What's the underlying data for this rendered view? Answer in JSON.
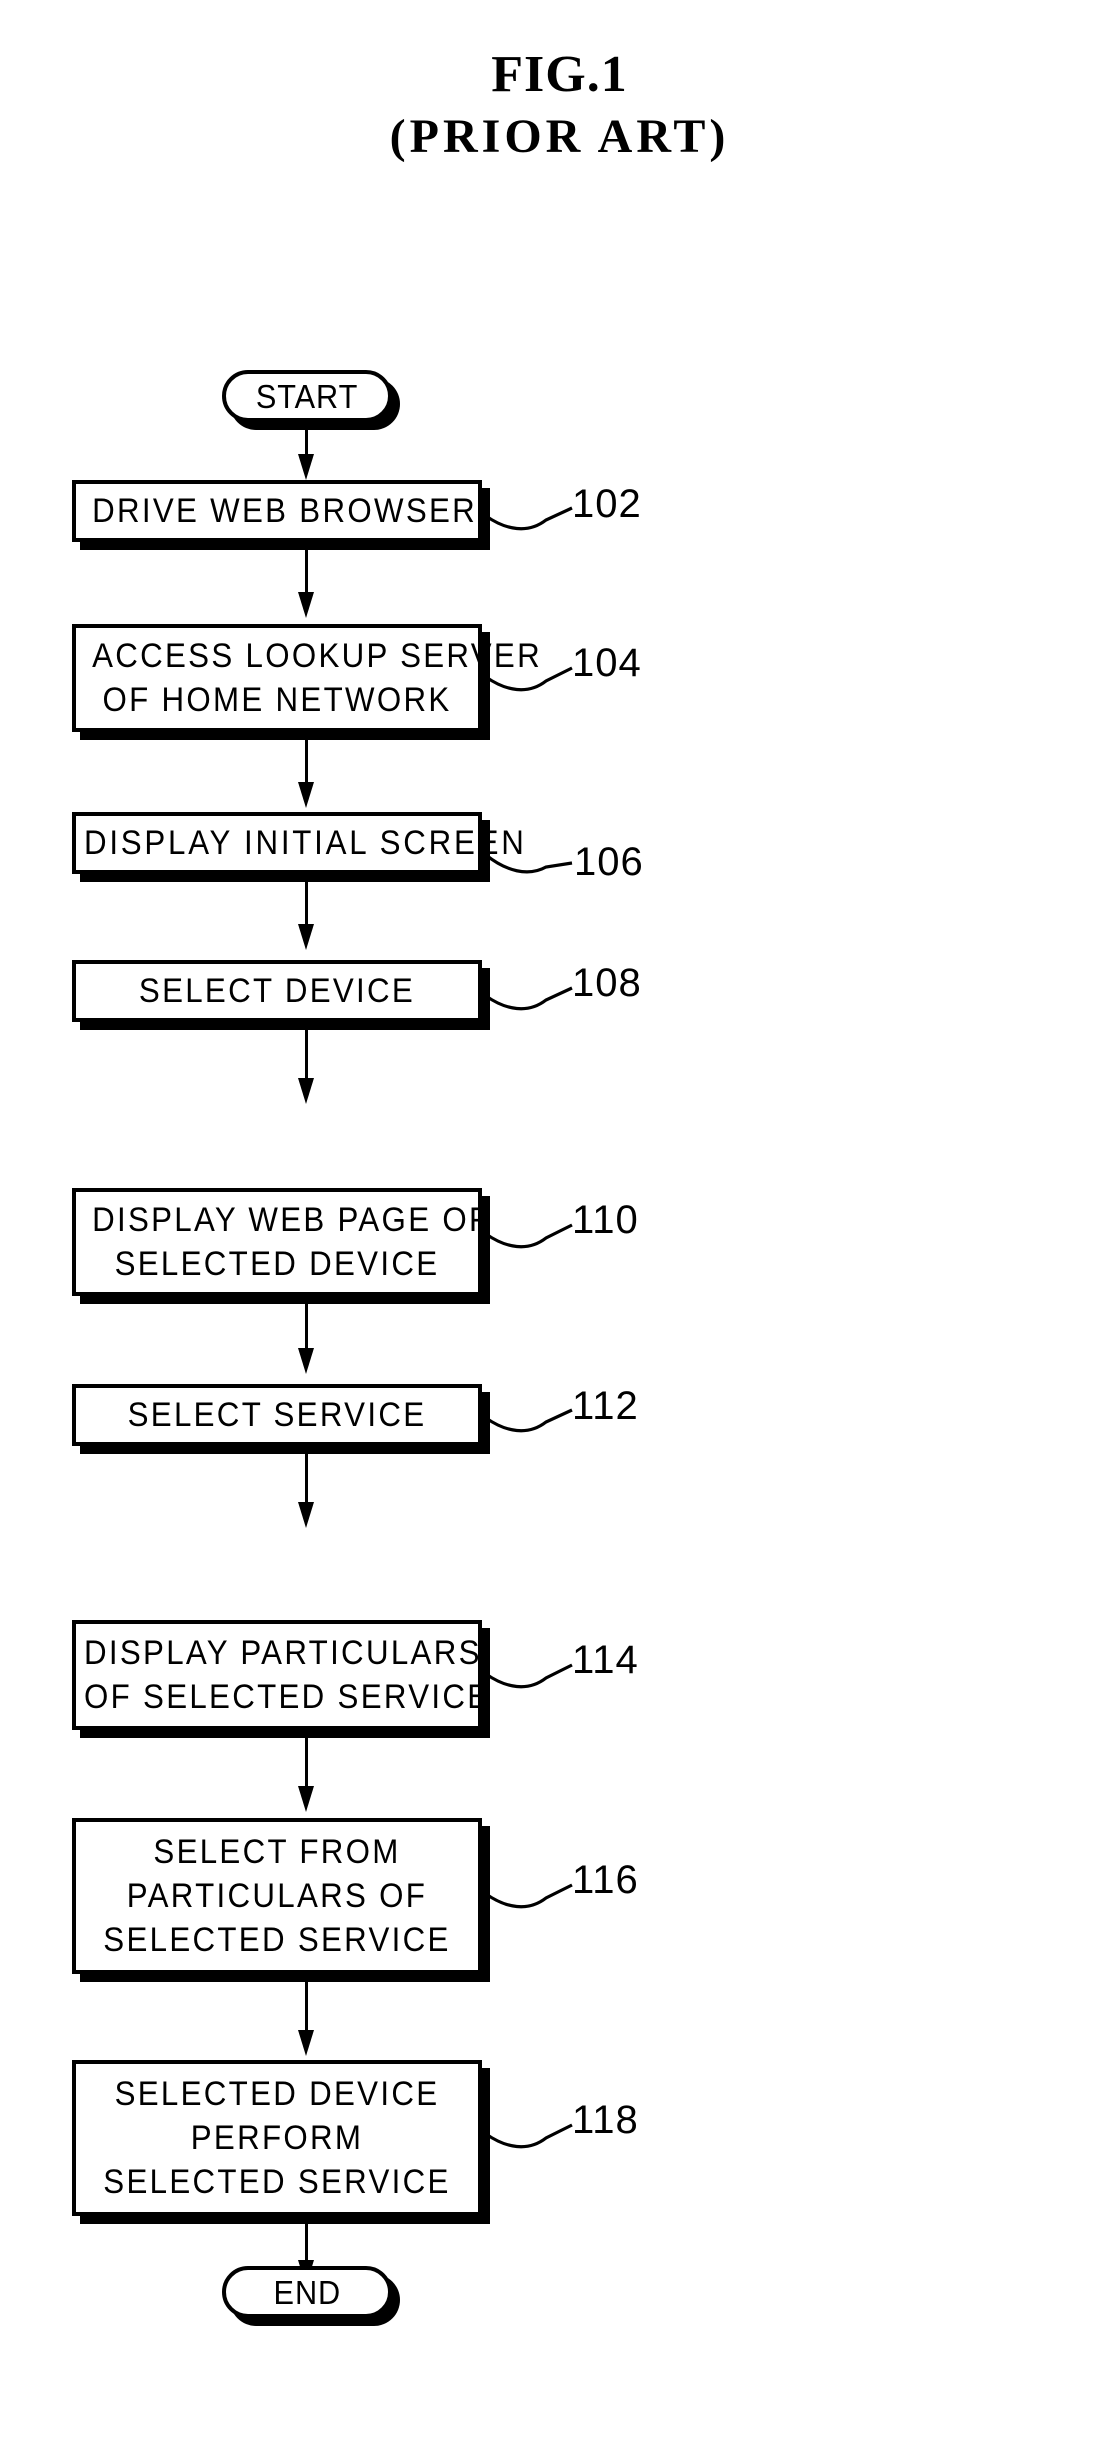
{
  "figure": {
    "title": "FIG.1",
    "subtitle": "(PRIOR ART)"
  },
  "diagram_data": {
    "type": "flowchart",
    "orientation": "top-to-bottom",
    "terminators": [
      {
        "id": "start",
        "label": "START"
      },
      {
        "id": "end",
        "label": "END"
      }
    ],
    "steps": [
      {
        "ref": "102",
        "lines": [
          "DRIVE WEB BROWSER"
        ]
      },
      {
        "ref": "104",
        "lines": [
          "ACCESS LOOKUP SERVER",
          "OF HOME NETWORK"
        ]
      },
      {
        "ref": "106",
        "lines": [
          "DISPLAY INITIAL SCREEN"
        ]
      },
      {
        "ref": "108",
        "lines": [
          "SELECT DEVICE"
        ]
      },
      {
        "ref": "110",
        "lines": [
          "DISPLAY WEB PAGE OF",
          "SELECTED DEVICE"
        ]
      },
      {
        "ref": "112",
        "lines": [
          "SELECT SERVICE"
        ]
      },
      {
        "ref": "114",
        "lines": [
          "DISPLAY PARTICULARS",
          "OF SELECTED SERVICE"
        ]
      },
      {
        "ref": "116",
        "lines": [
          "SELECT FROM",
          "PARTICULARS OF",
          "SELECTED SERVICE"
        ]
      },
      {
        "ref": "118",
        "lines": [
          "SELECTED DEVICE",
          "PERFORM",
          "SELECTED SERVICE"
        ]
      }
    ],
    "reference_numerals": [
      "102",
      "104",
      "106",
      "108",
      "110",
      "112",
      "114",
      "116",
      "118"
    ],
    "colors": {
      "ink": "#000000",
      "paper": "#ffffff"
    }
  }
}
